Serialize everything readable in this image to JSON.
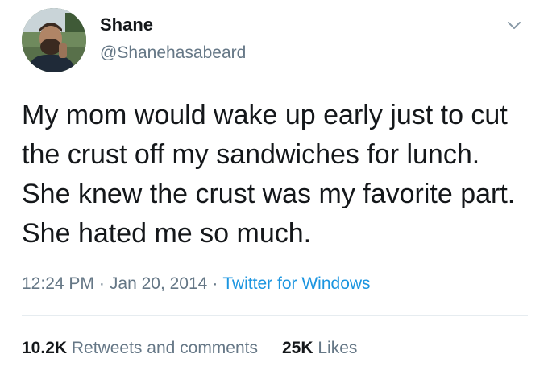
{
  "user": {
    "display_name": "Shane",
    "handle": "@Shanehasabeard",
    "avatar_icon": "profile-photo"
  },
  "menu": {
    "icon": "chevron-down-icon"
  },
  "tweet": {
    "text": "My mom would wake up early just to cut the crust off my sandwiches for lunch. She knew the crust was my favorite part. She hated me so much."
  },
  "meta": {
    "time": "12:24 PM",
    "separator": "·",
    "date": "Jan 20, 2014",
    "source": "Twitter for Windows"
  },
  "stats": {
    "retweets_count": "10.2K",
    "retweets_label": "Retweets and comments",
    "likes_count": "25K",
    "likes_label": "Likes"
  },
  "colors": {
    "text": "#14171a",
    "secondary": "#657786",
    "link": "#1b95e0",
    "divider": "#e6ecf0"
  }
}
